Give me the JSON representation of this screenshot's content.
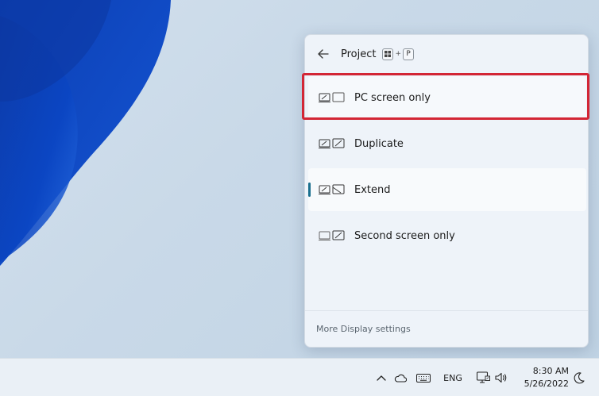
{
  "flyout": {
    "title": "Project",
    "shortcut": {
      "key1": "win-key-icon",
      "plus": "+",
      "key2": "P"
    },
    "options": [
      {
        "label": "PC screen only",
        "icon": "pc-screen-only-icon",
        "highlighted": true
      },
      {
        "label": "Duplicate",
        "icon": "duplicate-icon"
      },
      {
        "label": "Extend",
        "icon": "extend-icon",
        "selected": true
      },
      {
        "label": "Second screen only",
        "icon": "second-screen-only-icon"
      }
    ],
    "footer": "More Display settings"
  },
  "taskbar": {
    "language": "ENG",
    "time": "8:30 AM",
    "date": "5/26/2022",
    "tray_icons": [
      "chevron-up-icon",
      "onedrive-cloud-icon",
      "keyboard-icon",
      "network-monitor-icon",
      "volume-icon",
      "moon-icon"
    ]
  },
  "colors": {
    "highlight": "#d32635",
    "selected_indicator": "#1a6f8e",
    "wallpaper_blue": "#0a47c8"
  }
}
